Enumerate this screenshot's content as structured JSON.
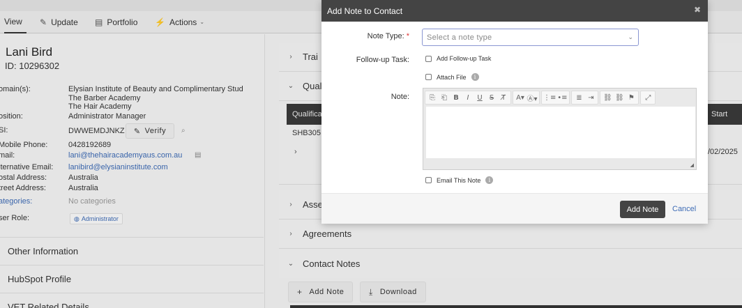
{
  "tabs": [
    {
      "label": "View",
      "icon": "none"
    },
    {
      "label": "Update",
      "icon": "pencil-icon"
    },
    {
      "label": "Portfolio",
      "icon": "portfolio-icon"
    },
    {
      "label": "Actions",
      "icon": "lightning-icon"
    }
  ],
  "contact": {
    "name": "Lani Bird",
    "id_line": "ID: 10296302",
    "fields": {
      "domains_label": "omain(s):",
      "domains": [
        "Elysian Institute of Beauty and Complimentary Stud",
        "The Barber Academy",
        "The Hair Academy"
      ],
      "position_label": "osition:",
      "position": "Administrator Manager",
      "usi_label": "SI:",
      "usi": "DWWEMDJNKZ",
      "verify_label": "Verify",
      "mobile_label": "Mobile Phone:",
      "mobile": "0428192689",
      "email_label": "mail:",
      "email": "lani@thehairacademyaus.com.au",
      "alt_email_label": "lternative Email:",
      "alt_email": "lanibird@elysianinstitute.com",
      "postal_label": "ostal Address:",
      "postal": "Australia",
      "street_label": "treet Address:",
      "street": "Australia",
      "categories_label": "ategories:",
      "categories": "No categories",
      "role_label": "ser Role:",
      "role": "Administrator"
    },
    "sections": [
      "Other Information",
      "HubSpot Profile",
      "VET Related Details"
    ]
  },
  "right": {
    "acc_training": "Trai",
    "acc_qualifications": "Quali",
    "qual_header_1": "Qualifica",
    "qual_header_2": "Start",
    "qual_code": "SHB305",
    "qual_date": "/02/2025",
    "acc_assessments": "Asse",
    "acc_agreements": "Agreements",
    "acc_contact_notes": "Contact Notes",
    "add_note_label": "Add Note",
    "download_label": "Download"
  },
  "modal": {
    "title": "Add Note to Contact",
    "note_type_label": "Note Type:",
    "required_mark": "*",
    "note_type_placeholder": "Select a note type",
    "followup_label": "Follow-up Task:",
    "add_followup_label": "Add Follow-up Task",
    "attach_file_label": "Attach File",
    "note_label": "Note:",
    "email_note_label": "Email This Note",
    "submit_label": "Add Note",
    "cancel_label": "Cancel",
    "close_glyph": "✖"
  },
  "colors": {
    "link": "#3d6bb5",
    "modal_header": "#444444",
    "required": "#dd3333",
    "select_border": "#8a96d2"
  }
}
